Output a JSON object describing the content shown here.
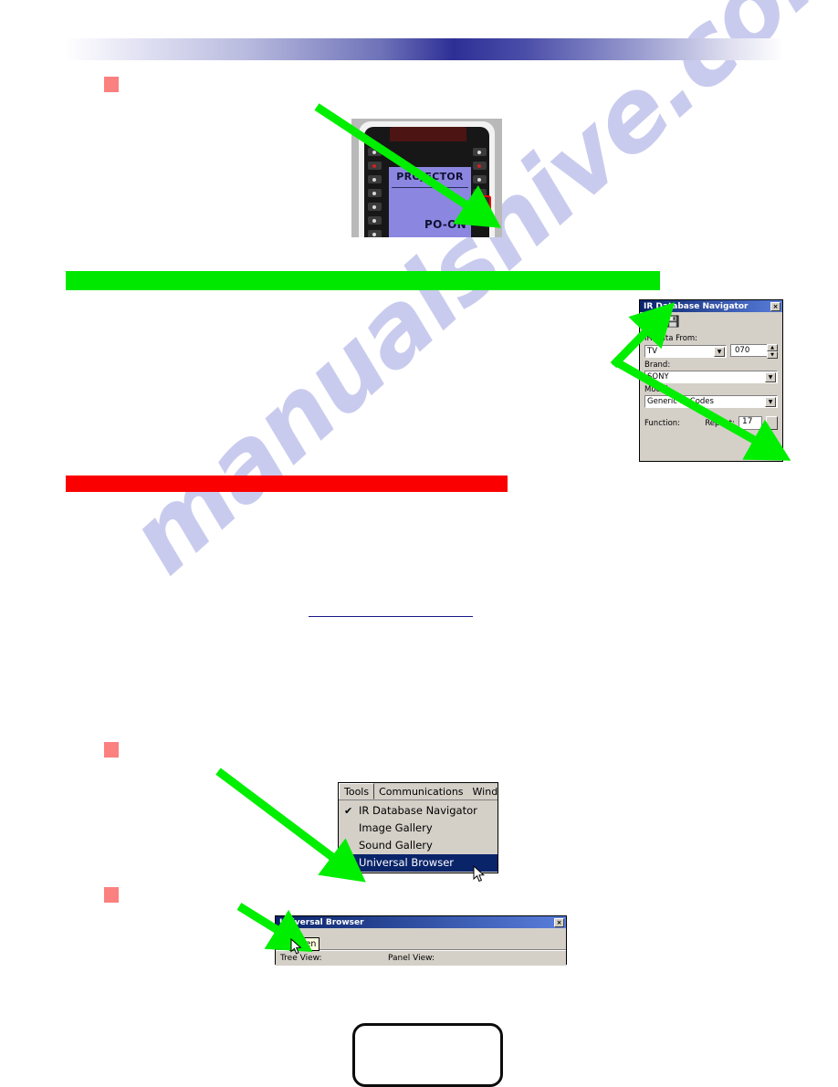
{
  "page": {
    "watermark": "manualshive.com",
    "header_band_color": "#2e2f96",
    "bullet_color": "#fb8080",
    "redaction_green": "#00e800",
    "redaction_red": "#fb0000"
  },
  "remote": {
    "lcd_title": "PROJECTOR",
    "lcd_label": "PO-ON",
    "lcd_color": "#8b87e0",
    "highlight_color": "#ee0000"
  },
  "ir_navigator": {
    "title": "IR Database Navigator",
    "close_label": "×",
    "toolbar": {
      "ir_icon": "ir-signal-icon",
      "save_icon": "save-disk-icon"
    },
    "data_from_label": "IR Data From:",
    "data_from_value": "TV",
    "code_value": "070",
    "brand_label": "Brand:",
    "brand_value": "SONY",
    "model_label": "Model:",
    "model_value": "Generic IR Codes",
    "function_label": "Function:",
    "repeat_label": "Repeat:",
    "repeat_value": "17",
    "dropdown_arrow": "▼",
    "spin_up": "▲",
    "spin_down": "▼"
  },
  "tools_menu": {
    "menubar": [
      {
        "label": "Tools",
        "accel": "",
        "active": true
      },
      {
        "label": "Communications",
        "accel": "C",
        "active": false
      },
      {
        "label": "Wind",
        "accel": "W",
        "active": false
      }
    ],
    "items": [
      {
        "label": "IR Database Navigator",
        "checked": true,
        "selected": false
      },
      {
        "label": "Image Gallery",
        "checked": false,
        "selected": false
      },
      {
        "label": "Sound Gallery",
        "checked": false,
        "selected": false
      },
      {
        "label": "Universal Browser",
        "checked": false,
        "selected": true
      }
    ],
    "check_glyph": "✔"
  },
  "universal_browser": {
    "title": "Universal Browser",
    "close_label": "×",
    "open_icon": "open-folder-icon",
    "tooltip": "Open",
    "tree_view_label": "Tree View:",
    "panel_view_label": "Panel View:"
  }
}
